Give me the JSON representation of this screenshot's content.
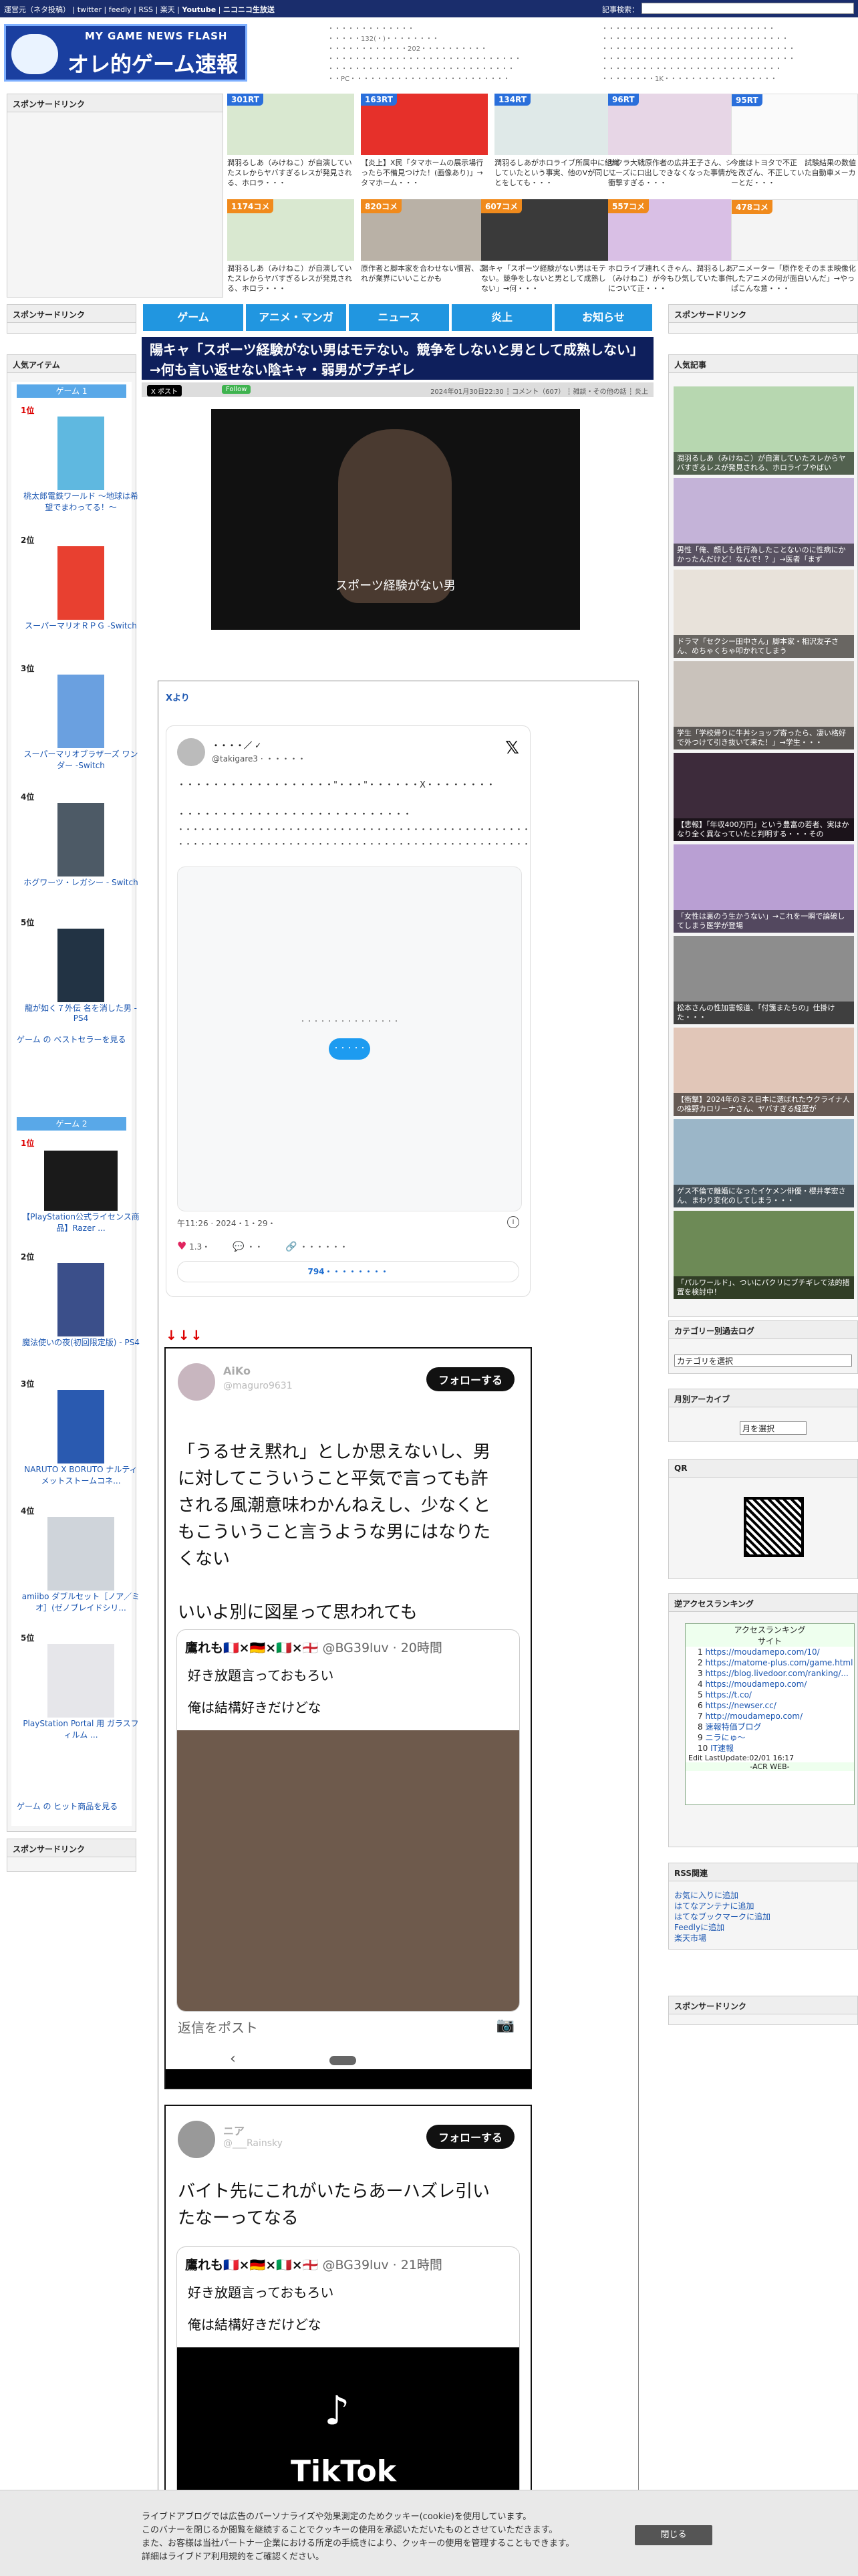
{
  "topbar": {
    "links": [
      "運営元（ネタ投稿）",
      "twitter",
      "feedly",
      "RSS",
      "楽天",
      "Youtube",
      "ニコニコ生放送"
    ],
    "search_label": "記事検索："
  },
  "logo": {
    "eng": "MY GAME NEWS FLASH",
    "jp": "オレ的ゲーム速報@JIN"
  },
  "header_links_left": [
    "・・・・・・・・・・・・・",
    "・・・・・132(・)・・・・・・・・",
    "・・・・・・・・・・・・202・・・・・・・・・・",
    "・・・・・・・・・・・・・・・・・・・・・・・・・・・・・",
    "・・・・・・・・・・・・・・・・・・・・・・・・・・・・",
    "・・PC・・・・・・・・・・・・・・・・・・・・・・・・"
  ],
  "header_links_right": [
    "・・・・・・・・・・・・・・・・・・・・・・・・・・",
    "・・・・・・・・・・・・・・・・・・・・・・・・・・・・",
    "・・・・・・・・・・・・・・・・・・・・・・・・・・・・・",
    "・・・・・・・・・・・・・・・・・・・・・・・・・・・・・",
    "・・・・・・・・・・・・・・・・・・・・・・・・・・・",
    "・・・・・・・・1K・・・・・・・・・・・・・・・・・"
  ],
  "sponsored": "スポンサードリンク",
  "thumbs_row1": [
    {
      "badge": "301RT",
      "caption": "潤羽るしあ（みけねこ）が自演していたスレからヤバすぎるレスが発見される、ホロラ・・・"
    },
    {
      "badge": "163RT",
      "caption": "【炎上】X民「タマホームの展示場行ったら不備見つけた！(画像あり)」→タマホーム・・・"
    },
    {
      "badge": "134RT",
      "caption": "潤羽るしあがホロライブ所属中に組織していたという事実、他のVが同じことをしても・・・"
    },
    {
      "badge": "96RT",
      "caption": "サクラ大戦原作者の広井王子さん、シリーズに口出しできなくなった事情が衝撃すぎる・・・"
    },
    {
      "badge": "95RT",
      "caption": "今度はトヨタで不正　試験結果の数値を改ざん、不正していた自動車メーカーとだ・・・"
    }
  ],
  "thumbs_row2": [
    {
      "badge": "1174コメ",
      "caption": "潤羽るしあ（みけねこ）が自演していたスレからヤバすぎるレスが発見される、ホロラ・・・"
    },
    {
      "badge": "820コメ",
      "caption": "原作者と脚本家を合わせない慣習、これが業界にいいことかも"
    },
    {
      "badge": "607コメ",
      "caption": "陽キャ「スポーツ経験がない男はモテない。競争をしないと男として成熟しない」→何・・・"
    },
    {
      "badge": "557コメ",
      "caption": "ホロライブ連れくきゃん、潤羽るしあ（みけねこ）が今もひ気していた事件について正・・・"
    },
    {
      "badge": "478コメ",
      "caption": "アニメーター「原作をそのまま映像化したアニメの何が面白いんだ」→やっぱこんな意・・・"
    }
  ],
  "nav": [
    "ゲーム",
    "アニメ・マンガ",
    "ニュース",
    "炎上",
    "お知らせ"
  ],
  "article": {
    "title": "陽キャ「スポーツ経験がない男はモテない。競争をしないと男として成熟しない」→何も言い返せない陰キャ・弱男がブチギレ",
    "x_button": "X ポスト",
    "follow_button": "Follow",
    "meta": "2024年01月30日22:30 ┆ コメント（607） ┆ 雑談・その他の話 ┆ 炎上",
    "video_caption": "スポーツ経験がない男",
    "x_yori": "Xより",
    "arrows": "↓↓↓"
  },
  "tweet": {
    "name": "・・・・／ ✓",
    "handle": "@takigare3 · ・・・・・",
    "body": [
      "・・・・・・・・・・・・・・・・・・\"・・・\"・・・・・・X・・・・・・・・",
      "",
      "・・・・・・・・・・・・・・・・・・・・・・・・・・・",
      "・・・・・・・・・・・・・・・・・・・・・・・・・・・・・・・・・・・・・・・・・・・・・・・・",
      "・・・・・・・・・・・・・・・・・・・・・・・・・・・・・・・・・・・・・・・・・・・・・・・・"
    ],
    "load_text": "・・・・・・・・・・・・・・・",
    "load_button": "・・・・・",
    "time": "午11:26 · 2024・1・29・",
    "likes": "1.3・",
    "replies": "・・",
    "share": "・・・・・・",
    "read_replies": "794・・・・・・・・"
  },
  "phone1": {
    "name": "AiKo",
    "handle": "@maguro9631",
    "follow": "フォローする",
    "text": [
      "「うるせえ黙れ」としか思えないし、男",
      "に対してこういうこと平気で言っても許",
      "される風潮意味わかんねえし、少なくと",
      "もこういうこと言うような男にはなりた",
      "くない",
      "",
      "いいよ別に図星って思われても"
    ],
    "quote_name": "鷹れも🇫🇷×🇩🇪×🇮🇹×🏴󠁧󠁢󠁥󠁮󠁧󠁿",
    "quote_sub": "@BG39luv · 20時間",
    "quote_lines": [
      "好き放題言っておもろい",
      "俺は結構好きだけどな"
    ],
    "reply": "返信をポスト"
  },
  "phone2": {
    "name": "ニア",
    "handle": "@___Rainsky",
    "follow": "フォローする",
    "text": [
      "バイト先にこれがいたらあーハズレ引い",
      "たなーってなる"
    ],
    "quote_name": "鷹れも🇫🇷×🇩🇪×🇮🇹×🏴󠁧󠁢󠁥󠁮󠁧󠁿",
    "quote_sub": "@BG39luv · 21時間",
    "quote_lines": [
      "好き放題言っておもろい",
      "俺は結構好きだけどな"
    ],
    "tiktok": "TikTok"
  },
  "left_sidebar": {
    "popular_title": "人気アイテム",
    "game_tab1": "ゲーム 1",
    "game_tab2": "ゲーム 2",
    "items1": [
      {
        "rank": "1位",
        "name": "桃太郎電鉄ワールド ～地球は希望でまわってる！～"
      },
      {
        "rank": "2位",
        "name": "スーパーマリオＲＰＧ -Switch"
      },
      {
        "rank": "3位",
        "name": "スーパーマリオブラザーズ ワンダー -Switch"
      },
      {
        "rank": "4位",
        "name": "ホグワーツ・レガシー - Switch"
      },
      {
        "rank": "5位",
        "name": "龍が如く７外伝 名を消した男 - PS4"
      }
    ],
    "more1": "ゲーム の ベストセラーを見る",
    "items2": [
      {
        "rank": "1位",
        "name": "【PlayStation公式ライセンス商品】Razer ..."
      },
      {
        "rank": "2位",
        "name": "魔法使いの夜(初回限定版) - PS4"
      },
      {
        "rank": "3位",
        "name": "NARUTO X BORUTO ナルティメットストームコネ..."
      },
      {
        "rank": "4位",
        "name": "amiibo ダブルセット［ノア／ミオ］(ゼノブレイドシリ..."
      },
      {
        "rank": "5位",
        "name": "PlayStation Portal 用 ガラスフィルム ..."
      }
    ],
    "more2": "ゲーム の ヒット商品を見る"
  },
  "right_sidebar": {
    "popular_title": "人気記事",
    "popular": [
      "潤羽るしあ（みけねこ）が自演していたスレからヤバすぎるレスが発見される、ホロライブやばい",
      "男性「俺、顔しも性行為したことないのに性病にかかったんだけど！なんで！？」→医者「まず",
      "ドラマ「セクシー田中さん」脚本家・相沢友子さん、めちゃくちゃ叩かれてしまう",
      "学生「学校帰りに牛丼ショップ寄ったら、凄い格好で外つけて引き抜いて来た！」→学生・・・",
      "【悲報】「年収400万円」という豊富の若者、実はかなり全く異なっていたと判明する・・・その",
      "「女性は裏のう生かうない」→これを一瞬で論破してしまう医学が登場",
      "松本さんの性加害報道、「付箋またちの」仕掛けた・・・",
      "【衝撃】2024年のミス日本に選ばれたウクライナ人の椎野カロリーナさん、ヤバすぎる経歴が",
      "ゲス不倫で離婚になったイケメン俳優・櫻井孝宏さん、まわり変化のしてしまう・・・",
      "「パルワールド」、ついにパクリにブチギレて法的措置を検討中！"
    ],
    "category_title": "カテゴリー別過去ログ",
    "category_select": "カテゴリを選択",
    "archive_title": "月別アーカイブ",
    "archive_select": "月を選択",
    "qr_title": "QR",
    "ranking_title": "逆アクセスランキング",
    "ranking_head": "アクセスランキング",
    "ranking_sub": "サイト",
    "ranking": [
      "https://moudamepo.com/10/",
      "https://matome-plus.com/game.html",
      "https://blog.livedoor.com/ranking/...",
      "https://moudamepo.com/",
      "https://t.co/",
      "https://newser.cc/",
      "http://moudamepo.com/",
      "速報特価ブログ",
      "ニラにゅ～",
      "IT速報"
    ],
    "ranking_foot": "Edit LastUpdate:02/01 16:17",
    "ranking_acr": "-ACR WEB-",
    "rss_title": "RSS関連",
    "rss_links": [
      "お気に入りに追加",
      "はてなアンテナに追加",
      "はてなブックマークに追加",
      "Feedlyに追加",
      "楽天市場"
    ]
  },
  "cookie": {
    "lines": [
      "ライブドアブログでは広告のパーソナライズや効果測定のためクッキー(cookie)を使用しています。",
      "このバナーを閉じるか閲覧を継続することでクッキーの使用を承認いただいたものとさせていただきます。",
      "また、お客様は当社パートナー企業における所定の手続きにより、クッキーの使用を管理することもできます。",
      "詳細はライブドア利用規約をご確認ください。"
    ],
    "close": "閉じる"
  }
}
